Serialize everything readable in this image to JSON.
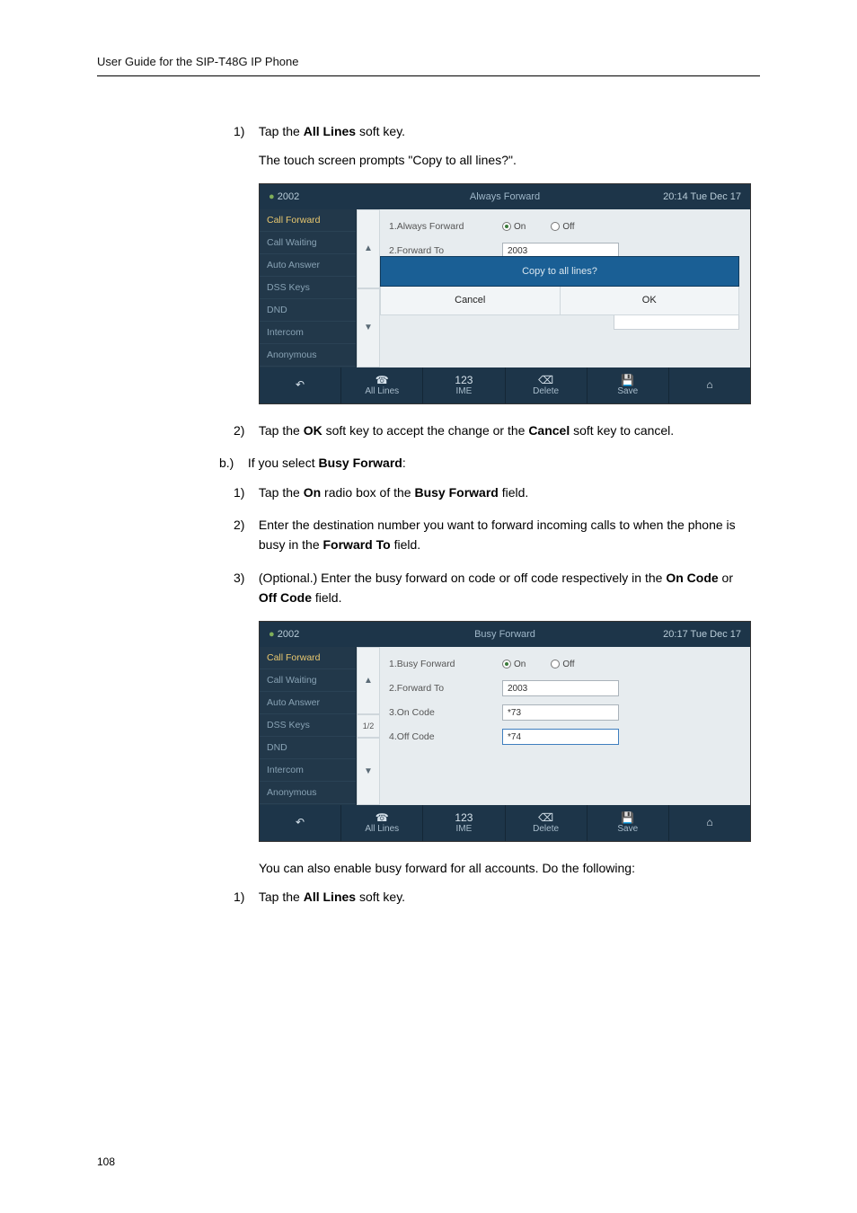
{
  "header": {
    "title": "User Guide for the SIP-T48G IP Phone"
  },
  "section1": {
    "step1": {
      "num": "1)",
      "pre": "Tap the ",
      "bold": "All Lines",
      "post": " soft key."
    },
    "step1_detail": "The touch screen prompts \"Copy to all lines?\".",
    "step2": {
      "num": "2)",
      "pre": "Tap the ",
      "b1": "OK",
      "mid": " soft key to accept the change or the ",
      "b2": "Cancel",
      "post": " soft key to cancel."
    }
  },
  "lettered_b": {
    "marker": "b.)",
    "pre": "If you select ",
    "bold": "Busy Forward",
    "post": ":"
  },
  "section2": {
    "s1": {
      "num": "1)",
      "pre": "Tap the ",
      "b1": "On",
      "mid": " radio box of the ",
      "b2": "Busy Forward",
      "post": " field."
    },
    "s2": {
      "num": "2)",
      "text_a": "Enter the destination number you want to forward incoming calls to when the phone is busy in the ",
      "b1": "Forward To",
      "text_b": " field."
    },
    "s3": {
      "num": "3)",
      "text_a": "(Optional.) Enter the busy forward on code or off code respectively in the ",
      "b1": "On Code",
      "mid": " or ",
      "b2": "Off Code",
      "text_b": " field."
    }
  },
  "after2": {
    "line": "You can also enable busy forward for all accounts. Do the following:",
    "s1": {
      "num": "1)",
      "pre": "Tap the ",
      "bold": "All Lines",
      "post": " soft key."
    }
  },
  "shot1": {
    "account": "2002",
    "title": "Always Forward",
    "clock": "20:14 Tue Dec 17",
    "side": [
      "Call Forward",
      "Call Waiting",
      "Auto Answer",
      "DSS Keys",
      "DND",
      "Intercom",
      "Anonymous"
    ],
    "row1_label": "1.Always Forward",
    "row2_label": "2.Forward To",
    "row2_value": "2003",
    "on": "On",
    "off": "Off",
    "prompt": "Copy to all lines?",
    "cancel": "Cancel",
    "ok": "OK",
    "soft": {
      "all_lines": "All Lines",
      "ime_top": "123",
      "ime": "IME",
      "delete": "Delete",
      "save": "Save"
    }
  },
  "shot2": {
    "account": "2002",
    "title": "Busy Forward",
    "clock": "20:17 Tue Dec 17",
    "side": [
      "Call Forward",
      "Call Waiting",
      "Auto Answer",
      "DSS Keys",
      "DND",
      "Intercom",
      "Anonymous"
    ],
    "row1_label": "1.Busy Forward",
    "row2_label": "2.Forward To",
    "row2_value": "2003",
    "row3_label": "3.On Code",
    "row3_value": "*73",
    "row4_label": "4.Off Code",
    "row4_value": "*74",
    "page_ind": "1/2",
    "on": "On",
    "off": "Off",
    "soft": {
      "all_lines": "All Lines",
      "ime_top": "123",
      "ime": "IME",
      "delete": "Delete",
      "save": "Save"
    }
  },
  "page_number": "108"
}
